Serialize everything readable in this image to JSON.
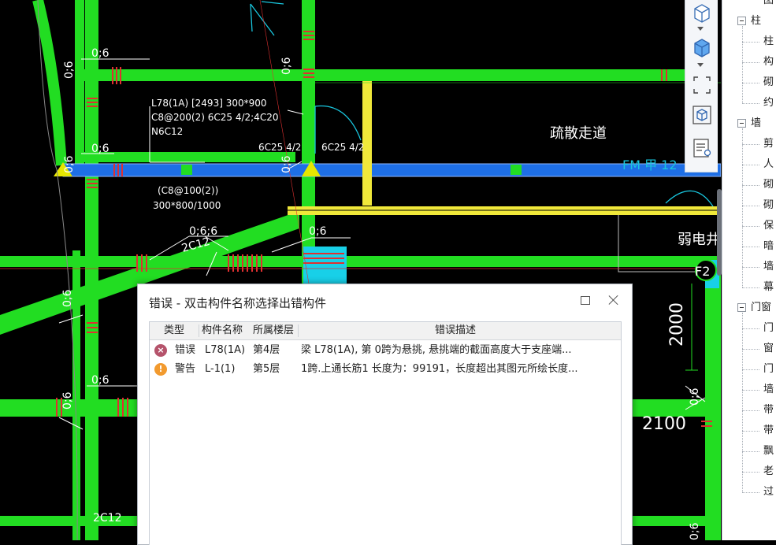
{
  "drawing": {
    "labels": {
      "beam_spec": "L78(1A) [2493] 300*900",
      "beam_stirrup": "C8@200(2) 6C25 4/2;4C20",
      "beam_side": "N6C12",
      "rebar_left": "6C25 4/2",
      "rebar_right": "6C25 4/2",
      "orig_stirrup": "(C8@100(2))",
      "orig_section": "300*800/1000",
      "corridor": "疏散走道",
      "elec_shaft": "弱电井",
      "grid_f2": "F2",
      "dim_2000": "2000",
      "dim_2100": "2100",
      "fm_tag": "FM 甲 12",
      "bar_2c12": "2C12",
      "bar_2c12_lower": "2C12",
      "wall_06": "0;6",
      "wall_066": "0;6;6"
    }
  },
  "toolbar": {
    "tools": [
      {
        "icon": "solid-box-icon"
      },
      {
        "icon": "blue-box-icon"
      },
      {
        "icon": "select-frame-icon"
      },
      {
        "icon": "3d-view-icon"
      },
      {
        "icon": "properties-list-icon"
      }
    ]
  },
  "tree": {
    "top_partial": "图",
    "groups": [
      {
        "label": "柱",
        "children": [
          "柱",
          "构",
          "砌",
          "约"
        ]
      },
      {
        "label": "墙",
        "children": [
          "剪",
          "人",
          "砌",
          "砌",
          "保",
          "暗",
          "墙",
          "幕"
        ]
      },
      {
        "label": "门窗",
        "children": [
          "门",
          "窗",
          "门",
          "墙",
          "带",
          "带",
          "飘",
          "老",
          "过"
        ]
      }
    ]
  },
  "dialog": {
    "title": "错误 - 双击构件名称选择出错构件",
    "columns": {
      "type": "类型",
      "name": "构件名称",
      "floor": "所属楼层",
      "desc": "错误描述"
    },
    "rows": [
      {
        "severity": "error",
        "icon": "error-icon",
        "color": "#b5536b",
        "glyph": "×",
        "type": "错误",
        "name": "L78(1A)",
        "floor": "第4层",
        "desc": "梁 L78(1A), 第 0跨为悬挑, 悬挑端的截面高度大于支座端..."
      },
      {
        "severity": "warning",
        "icon": "warning-icon",
        "color": "#f29a2e",
        "glyph": "!",
        "type": "警告",
        "name": "L-1(1)",
        "floor": "第5层",
        "desc": "1跨.上通长筋1 长度为：99191，长度超出其图元所绘长度..."
      }
    ]
  }
}
